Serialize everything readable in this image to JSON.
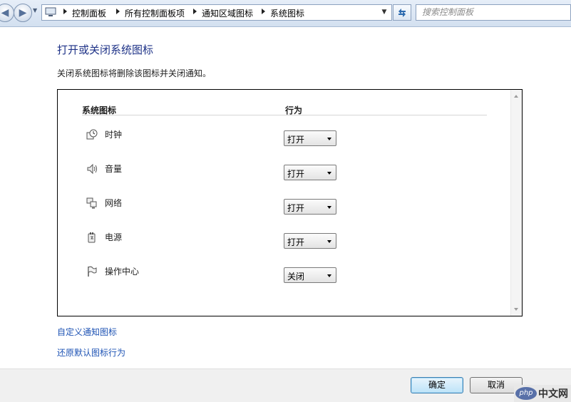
{
  "window": {
    "nav": {
      "back_icon": "back-arrow-icon",
      "forward_icon": "forward-arrow-icon"
    },
    "breadcrumbs": [
      "控制面板",
      "所有控制面板项",
      "通知区域图标",
      "系统图标"
    ],
    "search": {
      "placeholder": "搜索控制面板"
    }
  },
  "page": {
    "title": "打开或关闭系统图标",
    "description": "关闭系统图标将删除该图标并关闭通知。"
  },
  "table": {
    "headers": {
      "icon": "系统图标",
      "behavior": "行为"
    },
    "rows": [
      {
        "icon": "clock-icon",
        "label": "时钟",
        "value": "打开"
      },
      {
        "icon": "volume-icon",
        "label": "音量",
        "value": "打开"
      },
      {
        "icon": "network-icon",
        "label": "网络",
        "value": "打开"
      },
      {
        "icon": "power-icon",
        "label": "电源",
        "value": "打开"
      },
      {
        "icon": "action-center-flag-icon",
        "label": "操作中心",
        "value": "关闭"
      }
    ]
  },
  "links": {
    "customize": "自定义通知图标",
    "restore": "还原默认图标行为"
  },
  "footer": {
    "ok": "确定",
    "cancel": "取消"
  },
  "watermark": {
    "logo": "php",
    "text": "中文网"
  }
}
